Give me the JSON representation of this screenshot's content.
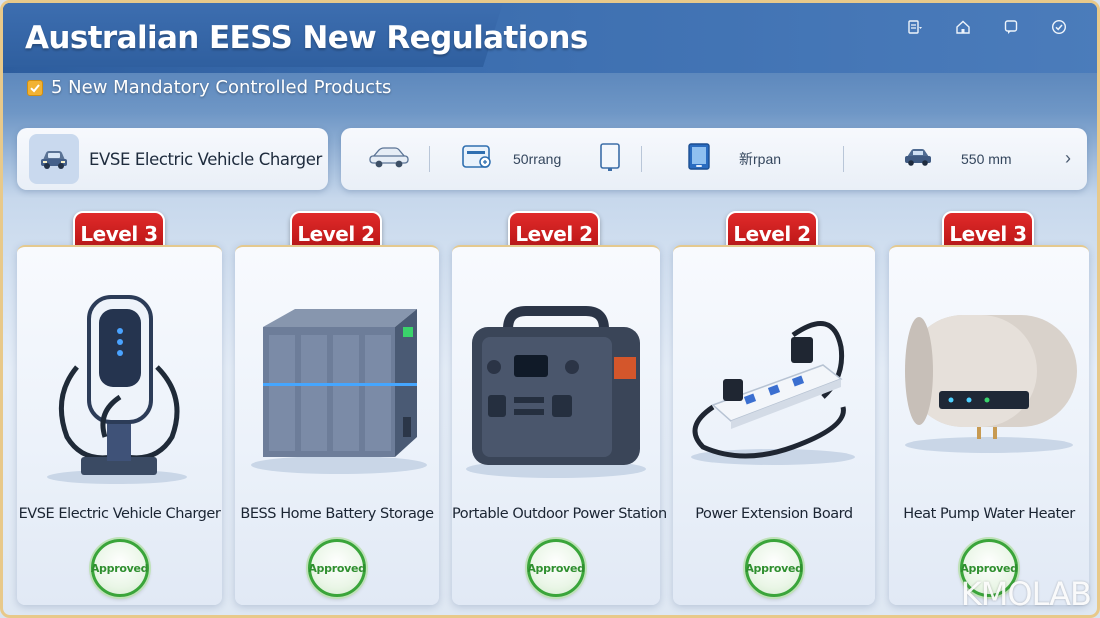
{
  "header": {
    "title": "Australian EESS New Regulations",
    "subtitle": "5 New Mandatory Controlled Products",
    "icons": [
      "document-menu-icon",
      "home-icon",
      "chat-icon",
      "check-circle-icon"
    ]
  },
  "feature": {
    "label": "EVSE Electric Vehicle Charger",
    "icon": "car-icon"
  },
  "strip": {
    "items": [
      {
        "icon": "car-icon",
        "text": ""
      },
      {
        "icon": "charger-screen-icon",
        "text": "50rrang"
      },
      {
        "icon": "tablet-icon",
        "text": ""
      },
      {
        "icon": "tablet-blue-icon",
        "text": "新rpan"
      },
      {
        "icon": "car-icon",
        "text": "550 mm"
      }
    ],
    "next_icon": "chevron-right-icon"
  },
  "products": [
    {
      "level": "Level 3",
      "name": "EVSE Electric Vehicle Charger",
      "status": "Approved"
    },
    {
      "level": "Level 2",
      "name": "BESS Home Battery Storage",
      "status": "Approved"
    },
    {
      "level": "Level 2",
      "name": "Portable Outdoor Power Station",
      "status": "Approved"
    },
    {
      "level": "Level 2",
      "name": "Power Extension Board",
      "status": "Approved"
    },
    {
      "level": "Level 3",
      "name": "Heat Pump Water Heater",
      "status": "Approved"
    }
  ],
  "watermark": "KMOLAB",
  "colors": {
    "header_blue": "#2f5f9f",
    "badge_red": "#c81d1d",
    "approved_green": "#3aa53a",
    "checkbox_orange": "#f2b233",
    "card_border_gold": "#e4c98f"
  }
}
